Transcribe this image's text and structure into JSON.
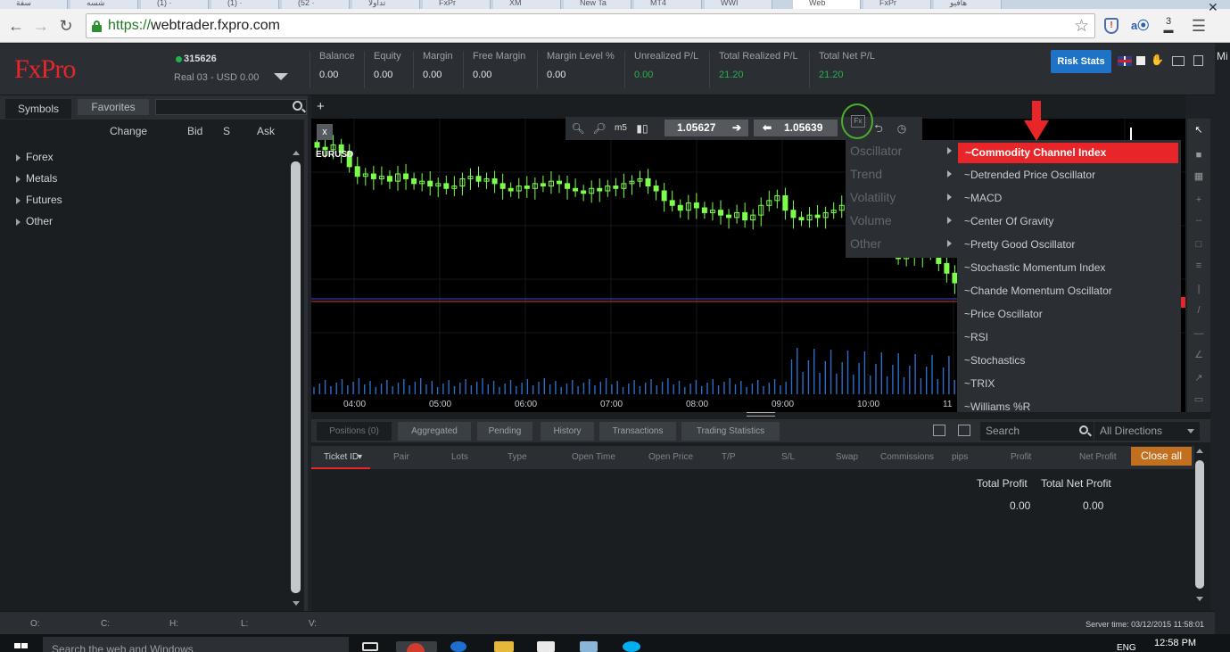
{
  "browser": {
    "tabs": [
      "سفة",
      "شسه",
      "(1) ·",
      "(1) ·",
      "(52 ·",
      "تداولا",
      "FxPr",
      "XM",
      "New Ta",
      "MT4",
      "WWI",
      "Web",
      "FxPr",
      "هافيو"
    ],
    "url_scheme": "https://",
    "url_host": "webtrader.fxpro.com",
    "ext_count": "3",
    "side_label": "Mi"
  },
  "header": {
    "logo": "FxPro",
    "account_id": "315626",
    "account_name": "Real 03 - USD 0.00",
    "metrics": [
      {
        "label": "Balance",
        "value": "0.00",
        "positive": false
      },
      {
        "label": "Equity",
        "value": "0.00",
        "positive": false
      },
      {
        "label": "Margin",
        "value": "0.00",
        "positive": false
      },
      {
        "label": "Free Margin",
        "value": "0.00",
        "positive": false
      },
      {
        "label": "Margin Level %",
        "value": "0.00",
        "positive": false
      },
      {
        "label": "Unrealized P/L",
        "value": "0.00",
        "positive": true
      },
      {
        "label": "Total Realized P/L",
        "value": "21.20",
        "positive": true
      },
      {
        "label": "Total Net P/L",
        "value": "21.20",
        "positive": true
      }
    ],
    "risk_stats_label": "Risk Stats"
  },
  "symbols": {
    "tab_symbols": "Symbols",
    "tab_favorites": "Favorites",
    "col_change": "Change",
    "col_bid": "Bid",
    "col_s": "S",
    "col_ask": "Ask",
    "groups": [
      "Forex",
      "Metals",
      "Futures",
      "Other"
    ]
  },
  "chart": {
    "close_label": "x",
    "symbol": "EURUSD",
    "timeframe": "m5",
    "sell_price": "1.05627",
    "buy_price": "1.05639",
    "fx_label": "Fx",
    "add_tab": "+"
  },
  "chart_data": {
    "type": "candlestick",
    "symbol": "EURUSD",
    "x_ticks": [
      "04:00",
      "05:00",
      "06:00",
      "07:00",
      "08:00",
      "09:00",
      "10:00",
      "11"
    ],
    "closes": [
      1.0612,
      1.0611,
      1.0613,
      1.061,
      1.0604,
      1.06,
      1.0601,
      1.0599,
      1.06,
      1.0598,
      1.0601,
      1.0599,
      1.0597,
      1.0598,
      1.0596,
      1.0597,
      1.0595,
      1.0596,
      1.0599,
      1.06,
      1.0598,
      1.0599,
      1.0597,
      1.0595,
      1.0594,
      1.0596,
      1.0595,
      1.0597,
      1.0596,
      1.0598,
      1.0597,
      1.0595,
      1.0594,
      1.0593,
      1.0595,
      1.0594,
      1.0596,
      1.0595,
      1.0597,
      1.0598,
      1.0599,
      1.0596,
      1.0594,
      1.059,
      1.0588,
      1.0586,
      1.0589,
      1.0587,
      1.0585,
      1.0586,
      1.0584,
      1.0583,
      1.0585,
      1.0582,
      1.0584,
      1.0588,
      1.059,
      1.0592,
      1.0586,
      1.0583,
      1.0582,
      1.0584,
      1.0583,
      1.0585,
      1.0586,
      1.0588,
      1.0585,
      1.0584,
      1.0586,
      1.0583,
      1.058,
      1.0572,
      1.0566,
      1.0568,
      1.0567,
      1.0569,
      1.0568,
      1.0564,
      1.056,
      1.0556,
      1.055
    ]
  },
  "indicator_menu": {
    "categories": [
      "Oscillator",
      "Trend",
      "Volatility",
      "Volume",
      "Other"
    ],
    "oscillators": [
      "~Commodity Channel Index",
      "~Detrended Price Oscillator",
      "~MACD",
      "~Center Of Gravity",
      "~Pretty Good Oscillator",
      "~Stochastic Momentum Index",
      "~Chande Momentum Oscillator",
      "~Price Oscillator",
      "~RSI",
      "~Stochastics",
      "~TRIX",
      "~Williams %R"
    ]
  },
  "positions": {
    "tabs": [
      "Positions (0)",
      "Aggregated",
      "Pending",
      "History",
      "Transactions",
      "Trading Statistics"
    ],
    "search_placeholder": "Search",
    "directions": "All Directions",
    "columns": [
      "Ticket ID",
      "Pair",
      "Lots",
      "Type",
      "Open Time",
      "Open Price",
      "T/P",
      "S/L",
      "Swap",
      "Commissions",
      "pips",
      "Profit",
      "Net Profit"
    ],
    "close_all": "Close all",
    "total_profit_label": "Total Profit",
    "total_net_profit_label": "Total Net Profit",
    "total_profit": "0.00",
    "total_net_profit": "0.00"
  },
  "status": {
    "o": "O:",
    "c": "C:",
    "h": "H:",
    "l": "L:",
    "v": "V:",
    "server_time": "Server time: 03/12/2015 11:58:01"
  },
  "taskbar": {
    "search_text": "Search the web and Windows",
    "lang": "ENG",
    "time": "12:58 PM"
  },
  "colors": {
    "accent_red": "#e8262a",
    "accent_blue": "#1e73c6",
    "positive_green": "#23b24b",
    "candle_green": "#7cff4a",
    "close_all_orange": "#c0701f"
  }
}
